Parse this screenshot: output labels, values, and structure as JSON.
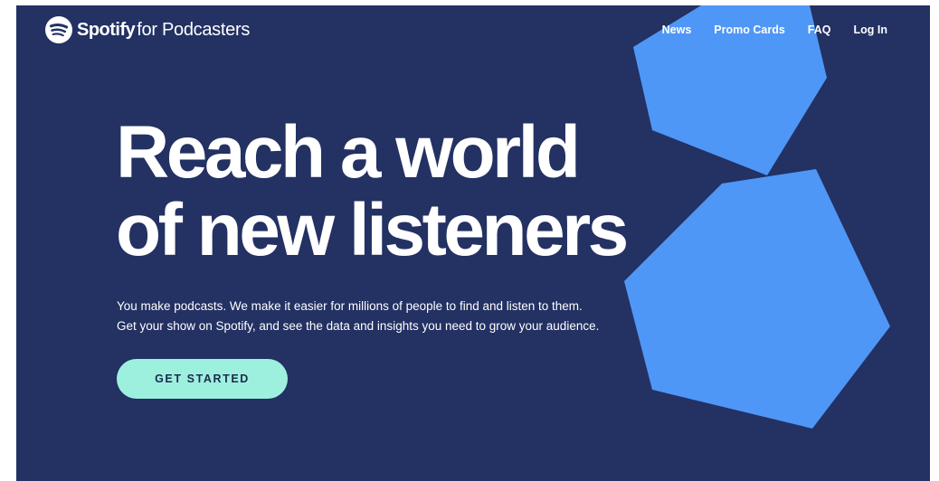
{
  "header": {
    "brand": "Spotify",
    "brand_suffix": "for Podcasters",
    "nav": [
      {
        "label": "News"
      },
      {
        "label": "Promo Cards"
      },
      {
        "label": "FAQ"
      },
      {
        "label": "Log In"
      }
    ]
  },
  "hero": {
    "headline_line1": "Reach a world",
    "headline_line2": "of new listeners",
    "subtext_line1": "You make podcasts. We make it easier for millions of people to find and listen to them.",
    "subtext_line2": "Get your show on Spotify, and see the data and insights you need to grow your audience.",
    "cta_label": "GET STARTED"
  },
  "colors": {
    "background": "#233163",
    "shape": "#4f97f6",
    "cta": "#9ef0de",
    "text": "#ffffff"
  },
  "icons": {
    "logo": "spotify-logo-icon"
  }
}
